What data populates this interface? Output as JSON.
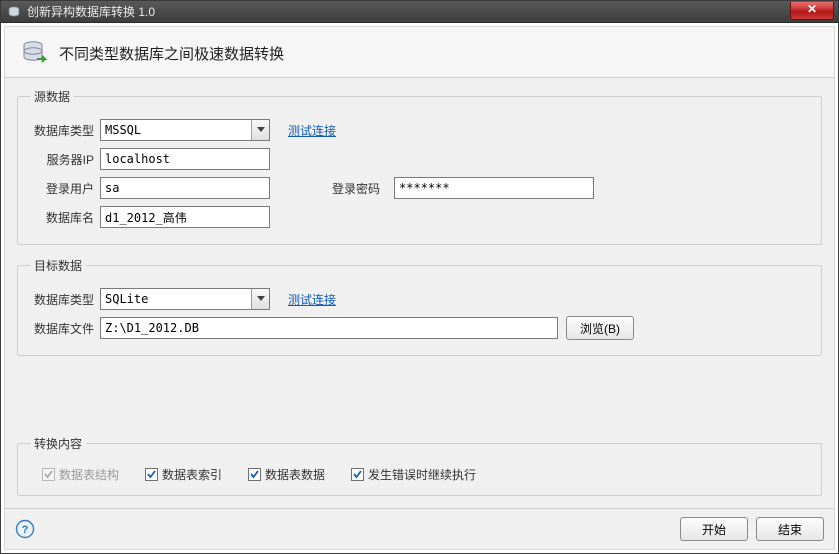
{
  "window": {
    "title": "创新异构数据库转换 1.0"
  },
  "header": {
    "title": "不同类型数据库之间极速数据转换"
  },
  "source": {
    "legend": "源数据",
    "dbTypeLabel": "数据库类型",
    "dbType": "MSSQL",
    "testLink": "测试连接",
    "serverIpLabel": "服务器IP",
    "serverIp": "localhost",
    "loginUserLabel": "登录用户",
    "loginUser": "sa",
    "loginPwdLabel": "登录密码",
    "loginPwd": "*******",
    "dbNameLabel": "数据库名",
    "dbName": "d1_2012_高伟"
  },
  "target": {
    "legend": "目标数据",
    "dbTypeLabel": "数据库类型",
    "dbType": "SQLite",
    "testLink": "测试连接",
    "dbFileLabel": "数据库文件",
    "dbFile": "Z:\\D1_2012.DB",
    "browse": "浏览(B)"
  },
  "options": {
    "legend": "转换内容",
    "schema": "数据表结构",
    "index": "数据表索引",
    "data": "数据表数据",
    "continueOnError": "发生错误时继续执行"
  },
  "footer": {
    "start": "开始",
    "end": "结束"
  }
}
